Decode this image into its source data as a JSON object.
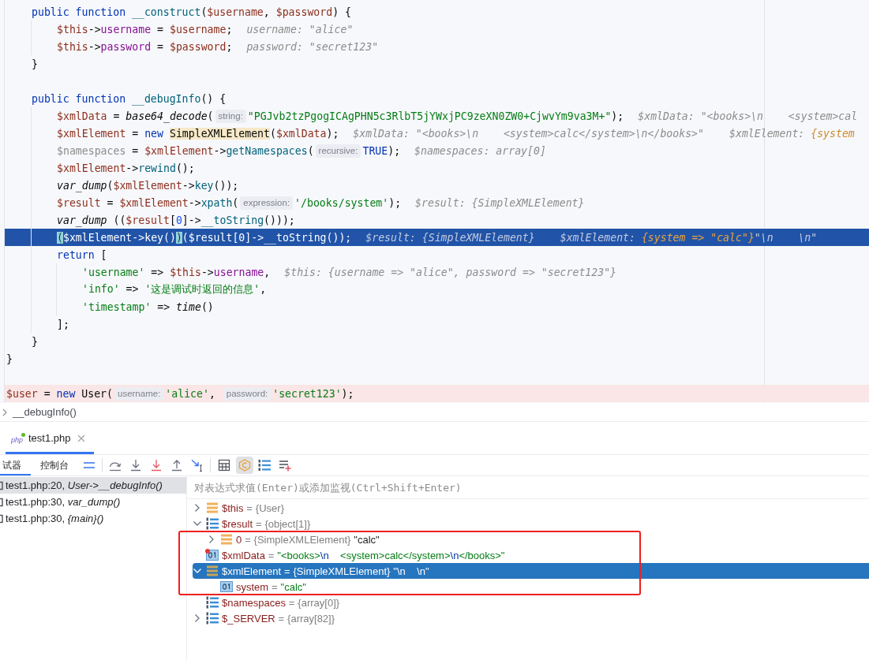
{
  "editor": {
    "lines": [
      {
        "kind": "block",
        "children": [
          {
            "kind": "code",
            "tokens": [
              {
                "kind": "kw",
                "text": "public "
              },
              {
                "kind": "kw",
                "text": "function "
              },
              {
                "kind": "fn",
                "text": "__construct"
              },
              {
                "kind": "plain",
                "text": "("
              },
              {
                "kind": "var",
                "text": "$username"
              },
              {
                "kind": "plain",
                "text": ", "
              },
              {
                "kind": "var",
                "text": "$password"
              },
              {
                "kind": "plain",
                "text": ") {"
              }
            ],
            "children": [
              {
                "kind": "code",
                "tokens": [
                  {
                    "kind": "var",
                    "text": "$this"
                  },
                  {
                    "kind": "plain",
                    "text": "->"
                  },
                  {
                    "kind": "prop",
                    "text": "username"
                  },
                  {
                    "kind": "plain",
                    "text": " = "
                  },
                  {
                    "kind": "var",
                    "text": "$username"
                  },
                  {
                    "kind": "plain",
                    "text": ";"
                  }
                ],
                "hints": [
                  {
                    "name": "username:",
                    "value": "\"alice\"",
                    "changed": false
                  }
                ]
              },
              {
                "kind": "code",
                "tokens": [
                  {
                    "kind": "var",
                    "text": "$this"
                  },
                  {
                    "kind": "plain",
                    "text": "->"
                  },
                  {
                    "kind": "prop",
                    "text": "password"
                  },
                  {
                    "kind": "plain",
                    "text": " = "
                  },
                  {
                    "kind": "var",
                    "text": "$password"
                  },
                  {
                    "kind": "plain",
                    "text": ";"
                  }
                ],
                "hints": [
                  {
                    "name": "password:",
                    "value": "\"secret123\"",
                    "changed": false
                  }
                ]
              }
            ]
          },
          {
            "kind": "code",
            "tokens": [
              {
                "kind": "plain",
                "text": "}"
              }
            ]
          },
          {
            "kind": "blank"
          },
          {
            "kind": "code",
            "tokens": [
              {
                "kind": "kw",
                "text": "public "
              },
              {
                "kind": "kw",
                "text": "function "
              },
              {
                "kind": "fn",
                "text": "__debugInfo"
              },
              {
                "kind": "plain",
                "text": "() {"
              }
            ],
            "children": [
              {
                "kind": "code",
                "tokens": [
                  {
                    "kind": "var",
                    "text": "$xmlData"
                  },
                  {
                    "kind": "plain",
                    "text": " = "
                  },
                  {
                    "kind": "builtin",
                    "text": "base64_decode"
                  },
                  {
                    "kind": "plain",
                    "text": "("
                  },
                  {
                    "kind": "param",
                    "text": "string:"
                  },
                  {
                    "kind": "str",
                    "text": "\"PGJvb2tzPgogICAgPHN5c3RlbT5jYWxjPC9zeXN0ZW0+CjwvYm9va3M+\""
                  },
                  {
                    "kind": "plain",
                    "text": ");"
                  }
                ],
                "hints": [
                  {
                    "name": "$xmlData:",
                    "value": "\"<books>\\n    <system>cal",
                    "changed": false
                  }
                ]
              },
              {
                "kind": "code",
                "tokens": [
                  {
                    "kind": "var",
                    "text": "$xmlElement"
                  },
                  {
                    "kind": "plain",
                    "text": " = "
                  },
                  {
                    "kind": "kw",
                    "text": "new "
                  },
                  {
                    "kind": "cls",
                    "text": "SimpleXMLElement"
                  },
                  {
                    "kind": "plain",
                    "text": "("
                  },
                  {
                    "kind": "var",
                    "text": "$xmlData"
                  },
                  {
                    "kind": "plain",
                    "text": ");"
                  }
                ],
                "hints": [
                  {
                    "name": "$xmlData:",
                    "value": "\"<books>\\n    <system>calc</system>\\n</books>\"",
                    "changed": false
                  },
                  {
                    "name": "$xmlElement:",
                    "value": "{system",
                    "changed": true
                  }
                ]
              },
              {
                "kind": "code",
                "tokens": [
                  {
                    "kind": "unused",
                    "text": "$namespaces"
                  },
                  {
                    "kind": "plain",
                    "text": " = "
                  },
                  {
                    "kind": "var",
                    "text": "$xmlElement"
                  },
                  {
                    "kind": "plain",
                    "text": "->"
                  },
                  {
                    "kind": "fn",
                    "text": "getNamespaces"
                  },
                  {
                    "kind": "plain",
                    "text": "("
                  },
                  {
                    "kind": "param",
                    "text": "recursive:"
                  },
                  {
                    "kind": "kw",
                    "text": "TRUE"
                  },
                  {
                    "kind": "plain",
                    "text": ");"
                  }
                ],
                "hints": [
                  {
                    "name": "$namespaces:",
                    "value": "array[0]",
                    "changed": false
                  }
                ]
              },
              {
                "kind": "code",
                "tokens": [
                  {
                    "kind": "var",
                    "text": "$xmlElement"
                  },
                  {
                    "kind": "plain",
                    "text": "->"
                  },
                  {
                    "kind": "fn",
                    "text": "rewind"
                  },
                  {
                    "kind": "plain",
                    "text": "();"
                  }
                ]
              },
              {
                "kind": "code",
                "tokens": [
                  {
                    "kind": "builtin",
                    "text": "var_dump"
                  },
                  {
                    "kind": "plain",
                    "text": "("
                  },
                  {
                    "kind": "var",
                    "text": "$xmlElement"
                  },
                  {
                    "kind": "plain",
                    "text": "->"
                  },
                  {
                    "kind": "fn",
                    "text": "key"
                  },
                  {
                    "kind": "plain",
                    "text": "());"
                  }
                ]
              },
              {
                "kind": "code",
                "tokens": [
                  {
                    "kind": "var",
                    "text": "$result"
                  },
                  {
                    "kind": "plain",
                    "text": " = "
                  },
                  {
                    "kind": "var",
                    "text": "$xmlElement"
                  },
                  {
                    "kind": "plain",
                    "text": "->"
                  },
                  {
                    "kind": "fn",
                    "text": "xpath"
                  },
                  {
                    "kind": "plain",
                    "text": "("
                  },
                  {
                    "kind": "param",
                    "text": "expression:"
                  },
                  {
                    "kind": "str",
                    "text": "'/books/system'"
                  },
                  {
                    "kind": "plain",
                    "text": ");"
                  }
                ],
                "hints": [
                  {
                    "name": "$result:",
                    "value": "{SimpleXMLElement}",
                    "changed": false
                  }
                ]
              },
              {
                "kind": "code",
                "tokens": [
                  {
                    "kind": "builtin",
                    "text": "var_dump"
                  },
                  {
                    "kind": "plain",
                    "text": " (("
                  },
                  {
                    "kind": "var",
                    "text": "$result"
                  },
                  {
                    "kind": "plain",
                    "text": "["
                  },
                  {
                    "kind": "num",
                    "text": "0"
                  },
                  {
                    "kind": "plain",
                    "text": "]->"
                  },
                  {
                    "kind": "fn",
                    "text": "__toString"
                  },
                  {
                    "kind": "plain",
                    "text": "()));"
                  }
                ]
              },
              {
                "kind": "current",
                "tokens": [
                  {
                    "kind": "brace",
                    "text": "("
                  },
                  {
                    "kind": "var",
                    "text": "$xmlElement"
                  },
                  {
                    "kind": "plain",
                    "text": "->"
                  },
                  {
                    "kind": "fn",
                    "text": "key"
                  },
                  {
                    "kind": "plain",
                    "text": "()"
                  },
                  {
                    "kind": "brace",
                    "text": ")"
                  },
                  {
                    "kind": "plain",
                    "text": "("
                  },
                  {
                    "kind": "var",
                    "text": "$result"
                  },
                  {
                    "kind": "plain",
                    "text": "["
                  },
                  {
                    "kind": "num",
                    "text": "0"
                  },
                  {
                    "kind": "plain",
                    "text": "]->"
                  },
                  {
                    "kind": "fn",
                    "text": "__toString"
                  },
                  {
                    "kind": "plain",
                    "text": "());"
                  }
                ],
                "hints": [
                  {
                    "name": "$result:",
                    "value": "{SimpleXMLElement}",
                    "changed": false
                  },
                  {
                    "name": "$xmlElement:",
                    "value": "{system => \"calc\"}",
                    "changed": true,
                    "tail": "\"\\n    \\n\""
                  }
                ]
              },
              {
                "kind": "code",
                "tokens": [
                  {
                    "kind": "kw",
                    "text": "return "
                  },
                  {
                    "kind": "plain",
                    "text": "["
                  }
                ],
                "children": [
                  {
                    "kind": "code",
                    "tokens": [
                      {
                        "kind": "str",
                        "text": "'username'"
                      },
                      {
                        "kind": "plain",
                        "text": " => "
                      },
                      {
                        "kind": "var",
                        "text": "$this"
                      },
                      {
                        "kind": "plain",
                        "text": "->"
                      },
                      {
                        "kind": "prop",
                        "text": "username"
                      },
                      {
                        "kind": "plain",
                        "text": ","
                      }
                    ],
                    "hints": [
                      {
                        "name": "$this:",
                        "value": "{username => \"alice\", password => \"secret123\"}",
                        "changed": false
                      }
                    ]
                  },
                  {
                    "kind": "code",
                    "tokens": [
                      {
                        "kind": "str",
                        "text": "'info'"
                      },
                      {
                        "kind": "plain",
                        "text": " => "
                      },
                      {
                        "kind": "str",
                        "text": "'这是调试时返回的信息'"
                      },
                      {
                        "kind": "plain",
                        "text": ","
                      }
                    ]
                  },
                  {
                    "kind": "code",
                    "tokens": [
                      {
                        "kind": "str",
                        "text": "'timestamp'"
                      },
                      {
                        "kind": "plain",
                        "text": " => "
                      },
                      {
                        "kind": "builtin",
                        "text": "time"
                      },
                      {
                        "kind": "plain",
                        "text": "()"
                      }
                    ]
                  }
                ]
              },
              {
                "kind": "code",
                "tokens": [
                  {
                    "kind": "plain",
                    "text": "];"
                  }
                ]
              }
            ]
          },
          {
            "kind": "code",
            "tokens": [
              {
                "kind": "plain",
                "text": "}"
              }
            ]
          }
        ]
      },
      {
        "kind": "code",
        "tokens": [
          {
            "kind": "plain",
            "text": "}"
          }
        ]
      },
      {
        "kind": "blank"
      },
      {
        "kind": "breakpoint",
        "tokens": [
          {
            "kind": "var",
            "text": "$user"
          },
          {
            "kind": "plain",
            "text": " = "
          },
          {
            "kind": "kw",
            "text": "new "
          },
          {
            "kind": "plain",
            "text": "User("
          },
          {
            "kind": "param",
            "text": "username:"
          },
          {
            "kind": "str",
            "text": "'alice'"
          },
          {
            "kind": "plain",
            "text": ", "
          },
          {
            "kind": "param",
            "text": "password:"
          },
          {
            "kind": "str",
            "text": "'secret123'"
          },
          {
            "kind": "plain",
            "text": ");"
          }
        ]
      }
    ]
  },
  "breadcrumb": {
    "text": "__debugInfo()"
  },
  "file_tabs": [
    {
      "label": "test1.php",
      "icon_label": "php",
      "selected": true
    }
  ],
  "debugger": {
    "tabs": [
      {
        "label": "试器",
        "selected": true
      },
      {
        "label": "控制台",
        "selected": false
      }
    ],
    "toggles": [
      {
        "on": false
      },
      {
        "on": true
      },
      {
        "on": false
      }
    ],
    "frames": [
      {
        "label": "test1.php:20, *User->__debugInfo()*",
        "selected": true
      },
      {
        "label": "test1.php:30, *var_dump()*",
        "selected": false
      },
      {
        "label": "test1.php:30, *{main}()*",
        "selected": false
      }
    ],
    "evaluate": {
      "placeholder": "对表达式求值(Enter)或添加监视(Ctrl+Shift+Enter)"
    },
    "variables": [
      {
        "name": "$this",
        "operator": "=",
        "type": "{User}",
        "kind": "object",
        "expanded": false,
        "selected": false,
        "marked": false
      },
      {
        "name": "$result",
        "operator": "=",
        "type": "{object[1]}",
        "kind": "array",
        "expanded": true,
        "selected": false,
        "marked": false,
        "children": [
          {
            "name": "0",
            "operator": "=",
            "type": "{SimpleXMLElement}",
            "value": "\"calc\"",
            "kind": "object",
            "expanded": false,
            "selected": false,
            "marked": false
          }
        ]
      },
      {
        "name": "$xmlData",
        "operator": "=",
        "value": "\"<books>\\n    <system>calc</system>\\n</books>\"",
        "kind": "scalar",
        "selected": false,
        "marked": true
      },
      {
        "name": "$xmlElement",
        "operator": "=",
        "type": "{SimpleXMLElement}",
        "value": "\"\\n    \\n\"",
        "kind": "object",
        "expanded": true,
        "selected": true,
        "marked": false,
        "children": [
          {
            "name": "system",
            "operator": "=",
            "value": "\"calc\"",
            "kind": "scalar",
            "selected": false,
            "marked": false
          }
        ]
      },
      {
        "name": "$namespaces",
        "operator": "=",
        "type": "{array[0]}",
        "kind": "array",
        "selected": false,
        "marked": false
      },
      {
        "name": "$_SERVER",
        "operator": "=",
        "type": "{array[82]}",
        "kind": "array",
        "expanded": false,
        "selected": false,
        "marked": false
      }
    ]
  }
}
